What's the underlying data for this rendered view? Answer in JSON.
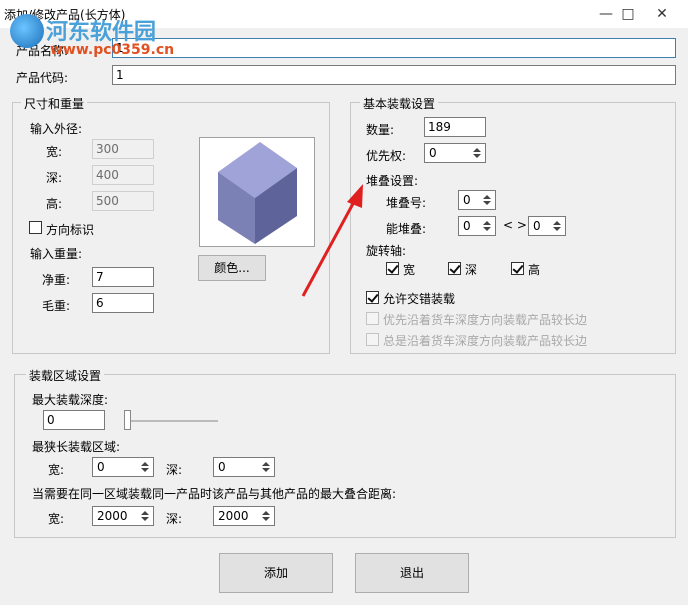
{
  "window": {
    "title": "添加/修改产品(长方体)",
    "minimize": "—",
    "maximize": "□",
    "close": "✕"
  },
  "watermark": {
    "text": "河东软件园",
    "url": "www.pc0359.cn"
  },
  "product": {
    "name_label": "产品名称:",
    "name_value": "1",
    "code_label": "产品代码:",
    "code_value": "1"
  },
  "size_weight": {
    "legend": "尺寸和重量",
    "outer_label": "输入外径:",
    "width_label": "宽:",
    "width_value": "300",
    "depth_label": "深:",
    "depth_value": "400",
    "height_label": "高:",
    "height_value": "500",
    "orientation_label": "方向标识",
    "weight_label": "输入重量:",
    "net_label": "净重:",
    "net_value": "7",
    "gross_label": "毛重:",
    "gross_value": "6",
    "color_button": "颜色..."
  },
  "basic": {
    "legend": "基本装载设置",
    "qty_label": "数量:",
    "qty_value": "189",
    "priority_label": "优先权:",
    "priority_value": "0",
    "stack_label": "堆叠设置:",
    "stack_no_label": "堆叠号:",
    "stack_no_value": "0",
    "can_stack_label": "能堆叠:",
    "can_stack_min": "0",
    "can_stack_sep": "< >",
    "can_stack_max": "0",
    "rotate_label": "旋转轴:",
    "rot_width": "宽",
    "rot_depth": "深",
    "rot_height": "高",
    "allow_interlace": "允许交错装载",
    "prefer_long": "优先沿着货车深度方向装载产品较长边",
    "always_long": "总是沿着货车深度方向装载产品较长边"
  },
  "area": {
    "legend": "装载区域设置",
    "max_depth_label": "最大装载深度:",
    "max_depth_value": "0",
    "narrow_label": "最狭长装载区域:",
    "narrow_width_label": "宽:",
    "narrow_width_value": "0",
    "narrow_depth_label": "深:",
    "narrow_depth_value": "0",
    "overlap_label": "当需要在同一区域装载同一产品时该产品与其他产品的最大叠合距离:",
    "overlap_width_label": "宽:",
    "overlap_width_value": "2000",
    "overlap_depth_label": "深:",
    "overlap_depth_value": "2000"
  },
  "buttons": {
    "add": "添加",
    "exit": "退出"
  },
  "colors": {
    "cube_front": "#7b80b5",
    "cube_top": "#9fa3d8",
    "cube_side": "#5e6399",
    "arrow": "#e02020"
  }
}
